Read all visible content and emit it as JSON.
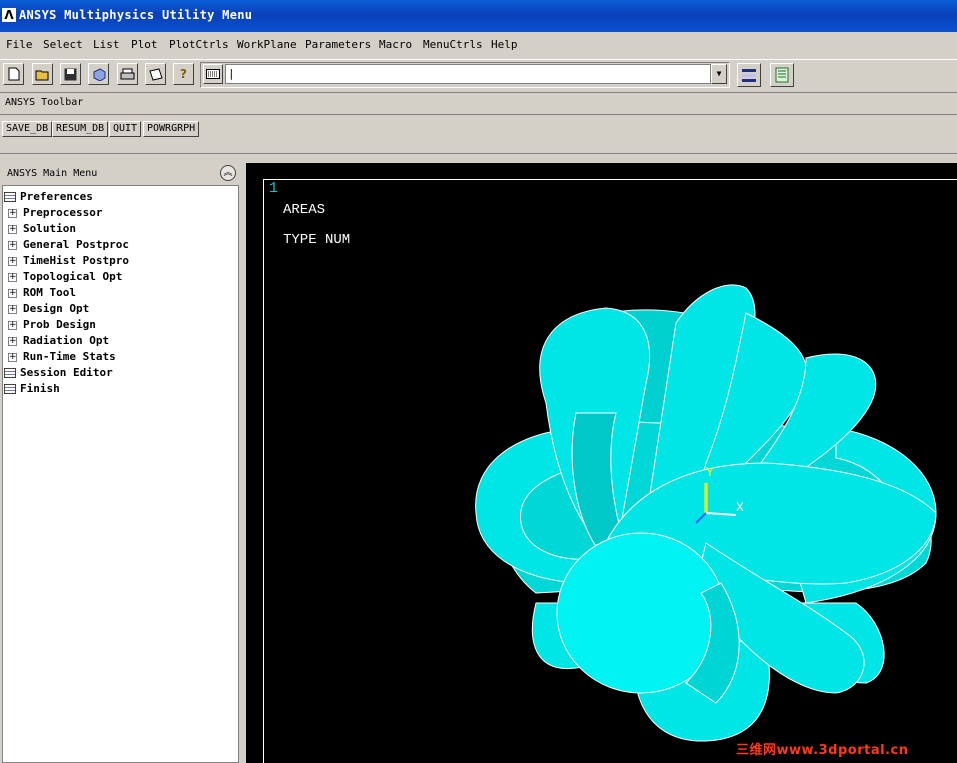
{
  "window": {
    "title": "ANSYS Multiphysics Utility Menu",
    "logo": "Λ"
  },
  "menubar": [
    {
      "label": "File"
    },
    {
      "label": "Select"
    },
    {
      "label": "List"
    },
    {
      "label": "Plot"
    },
    {
      "label": "PlotCtrls"
    },
    {
      "label": "WorkPlane"
    },
    {
      "label": "Parameters"
    },
    {
      "label": "Macro"
    },
    {
      "label": "MenuCtrls"
    },
    {
      "label": "Help"
    }
  ],
  "toolicons": [
    "new-icon",
    "open-icon",
    "save-icon",
    "3d-view-icon",
    "print-icon",
    "report-icon",
    "help-icon"
  ],
  "command": {
    "value": "|"
  },
  "toolbar": {
    "label": "ANSYS Toolbar",
    "buttons": [
      "SAVE_DB",
      "RESUM_DB",
      "QUIT",
      "POWRGRPH"
    ]
  },
  "main_menu": {
    "header": "ANSYS Main Menu",
    "items": [
      {
        "label": "Preferences",
        "icon": "document-icon"
      },
      {
        "label": "Preprocessor",
        "icon": "expand-icon"
      },
      {
        "label": "Solution",
        "icon": "expand-icon"
      },
      {
        "label": "General Postproc",
        "icon": "expand-icon"
      },
      {
        "label": "TimeHist Postpro",
        "icon": "expand-icon"
      },
      {
        "label": "Topological Opt",
        "icon": "expand-icon"
      },
      {
        "label": "ROM Tool",
        "icon": "expand-icon"
      },
      {
        "label": "Design Opt",
        "icon": "expand-icon"
      },
      {
        "label": "Prob Design",
        "icon": "expand-icon"
      },
      {
        "label": "Radiation Opt",
        "icon": "expand-icon"
      },
      {
        "label": "Run-Time Stats",
        "icon": "expand-icon"
      },
      {
        "label": "Session Editor",
        "icon": "document-icon"
      },
      {
        "label": "Finish",
        "icon": "document-icon"
      }
    ]
  },
  "graphics": {
    "window_number": "1",
    "line1": "AREAS",
    "line2": "TYPE NUM",
    "triad_y": "Y",
    "triad_x": "X",
    "model_color": "#00e0e0"
  },
  "watermark": "三维网www.3dportal.cn"
}
